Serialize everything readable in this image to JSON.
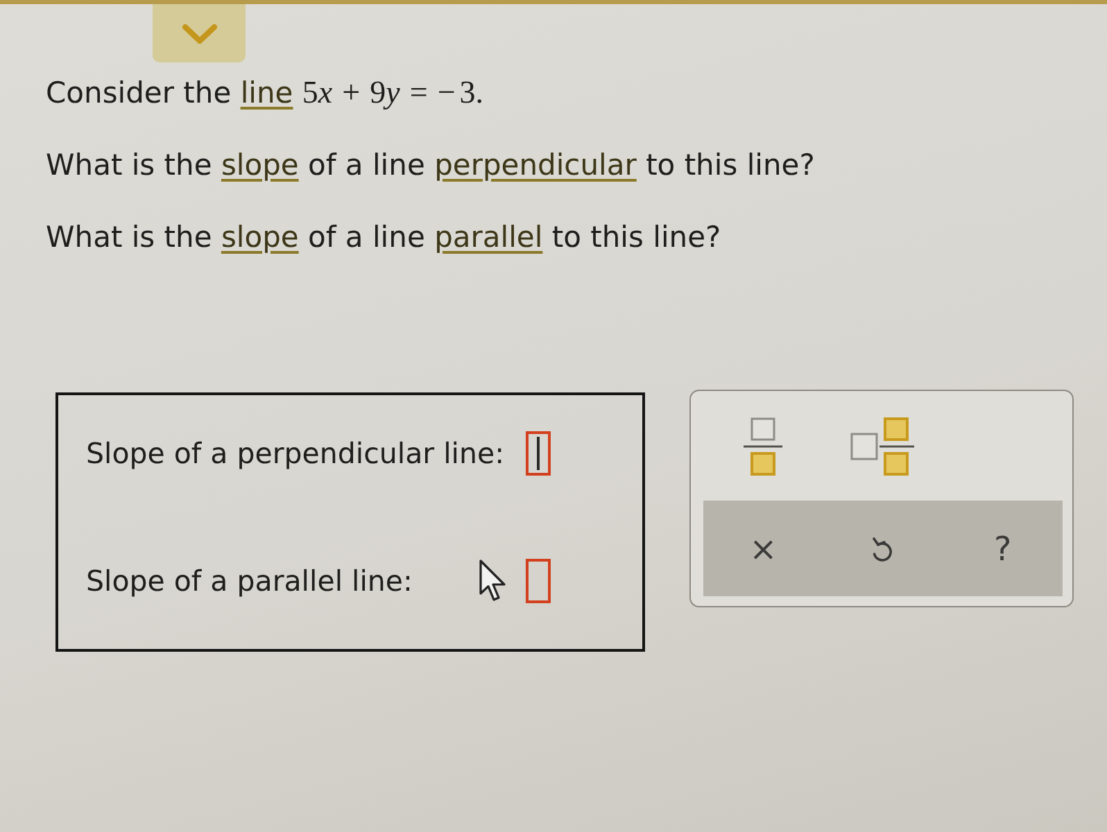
{
  "question": {
    "lines": [
      {
        "parts": [
          {
            "kind": "text",
            "text": "Consider the"
          },
          {
            "kind": "link",
            "text": "line"
          },
          {
            "kind": "math",
            "tokens": [
              {
                "kind": "num",
                "text": "5"
              },
              {
                "kind": "var",
                "text": "x"
              },
              {
                "kind": "op",
                "text": "+"
              },
              {
                "kind": "num",
                "text": "9"
              },
              {
                "kind": "var",
                "text": "y"
              },
              {
                "kind": "op",
                "text": "="
              },
              {
                "kind": "sign",
                "text": "−"
              },
              {
                "kind": "num",
                "text": "3."
              }
            ]
          }
        ]
      },
      {
        "parts": [
          {
            "kind": "text",
            "text": "What is the"
          },
          {
            "kind": "link",
            "text": "slope"
          },
          {
            "kind": "text",
            "text": "of a line"
          },
          {
            "kind": "link",
            "text": "perpendicular"
          },
          {
            "kind": "text",
            "text": "to this line?"
          }
        ]
      },
      {
        "parts": [
          {
            "kind": "text",
            "text": "What is the"
          },
          {
            "kind": "link",
            "text": "slope"
          },
          {
            "kind": "text",
            "text": "of a line"
          },
          {
            "kind": "link",
            "text": "parallel"
          },
          {
            "kind": "text",
            "text": "to this line?"
          }
        ]
      }
    ]
  },
  "answers": [
    {
      "label": "Slope of a perpendicular line:",
      "focused": true,
      "hovered": false
    },
    {
      "label": "Slope of a parallel line:",
      "focused": false,
      "hovered": true
    }
  ],
  "keypad": {
    "templates": [
      {
        "kind": "fraction"
      },
      {
        "kind": "mixed_number"
      }
    ],
    "actions": [
      {
        "kind": "clear",
        "symbol": "×"
      },
      {
        "kind": "undo"
      },
      {
        "kind": "help",
        "symbol": "?"
      }
    ]
  }
}
